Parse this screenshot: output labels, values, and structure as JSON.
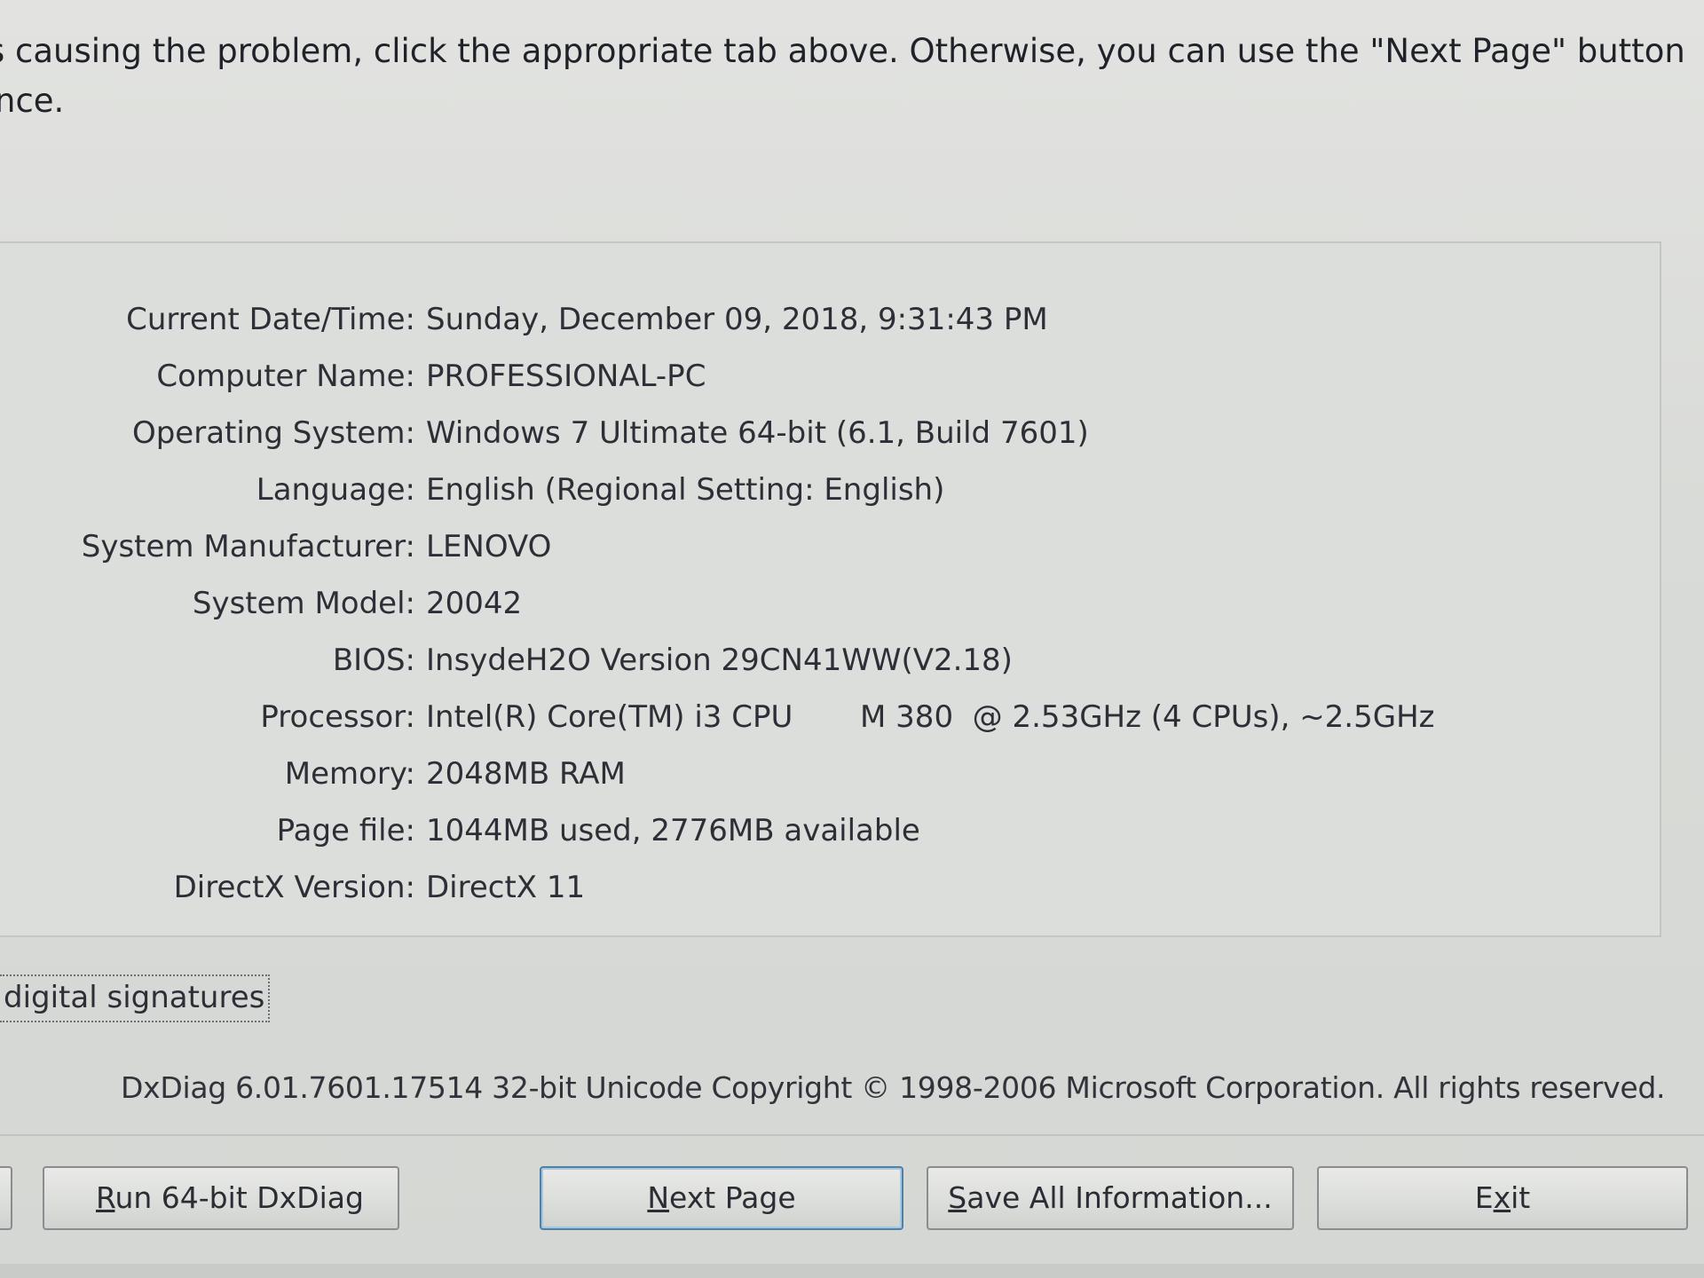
{
  "intro": {
    "line1": "s causing the problem, click the appropriate tab above.  Otherwise, you can use the \"Next Page\" button below to",
    "line2": "nce."
  },
  "system_info": {
    "rows": [
      {
        "label": "Current Date/Time:",
        "value": "Sunday, December 09, 2018, 9:31:43 PM"
      },
      {
        "label": "Computer Name:",
        "value": "PROFESSIONAL-PC"
      },
      {
        "label": "Operating System:",
        "value": "Windows 7 Ultimate 64-bit (6.1, Build 7601)"
      },
      {
        "label": "Language:",
        "value": "English (Regional Setting: English)"
      },
      {
        "label": "System Manufacturer:",
        "value": "LENOVO"
      },
      {
        "label": "System Model:",
        "value": "20042"
      },
      {
        "label": "BIOS:",
        "value": "InsydeH2O Version 29CN41WW(V2.18)"
      },
      {
        "label": "Processor:",
        "value": "Intel(R) Core(TM) i3 CPU       M 380  @ 2.53GHz (4 CPUs), ~2.5GHz"
      },
      {
        "label": "Memory:",
        "value": "2048MB RAM"
      },
      {
        "label": "Page file:",
        "value": "1044MB used, 2776MB available"
      },
      {
        "label": "DirectX Version:",
        "value": "DirectX 11"
      }
    ]
  },
  "checkbox": {
    "label": "digital signatures"
  },
  "footer": {
    "copyright": "DxDiag 6.01.7601.17514 32-bit Unicode  Copyright © 1998-2006 Microsoft Corporation.  All rights reserved."
  },
  "buttons": {
    "run_accel": "R",
    "run_rest": "un 64-bit DxDiag",
    "next_accel": "N",
    "next_rest": "ext Page",
    "save_accel": "S",
    "save_rest": "ave All Information...",
    "exit_pre": "E",
    "exit_accel": "x",
    "exit_post": "it"
  }
}
